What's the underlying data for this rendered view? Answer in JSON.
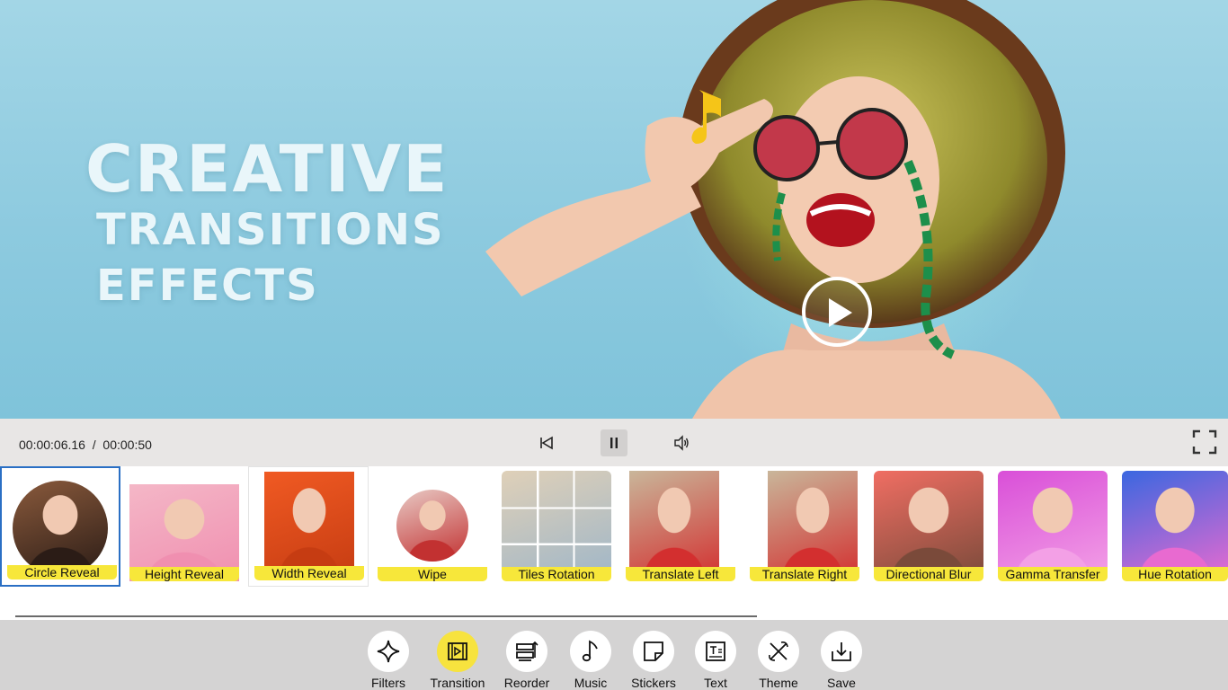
{
  "preview": {
    "headline": [
      "CREATIVE",
      "TRANSITIONS",
      "EFFECTS"
    ]
  },
  "player": {
    "current_time": "00:00:06.16",
    "separator": "/",
    "total_time": "00:00:50"
  },
  "transitions": [
    {
      "label": "Circle Reveal",
      "shape": "circle",
      "colors": [
        "#8a5a3c",
        "#2b1c16"
      ]
    },
    {
      "label": "Height Reveal",
      "shape": "rect",
      "colors": [
        "#f4b7c7",
        "#f08fb0"
      ]
    },
    {
      "label": "Width Reveal",
      "shape": "rect",
      "colors": [
        "#f05a23",
        "#c63c12"
      ]
    },
    {
      "label": "Wipe",
      "shape": "circle",
      "colors": [
        "#e8c9c4",
        "#c23131"
      ]
    },
    {
      "label": "Tiles Rotation",
      "shape": "grid",
      "colors": [
        "#dfd0b8",
        "#9fb6c8"
      ]
    },
    {
      "label": "Translate Left",
      "shape": "rect",
      "colors": [
        "#c9b69a",
        "#d32f2f"
      ]
    },
    {
      "label": "Translate Right",
      "shape": "rect",
      "colors": [
        "#c9b69a",
        "#d32f2f"
      ]
    },
    {
      "label": "Directional Blur",
      "shape": "rounded",
      "colors": [
        "#f06e63",
        "#7a4a3a"
      ]
    },
    {
      "label": "Gamma Transfer",
      "shape": "rounded",
      "colors": [
        "#d94fd8",
        "#f3a0e6"
      ]
    },
    {
      "label": "Hue Rotation",
      "shape": "rounded",
      "colors": [
        "#3a67e0",
        "#e86ad0"
      ]
    }
  ],
  "toolbar": [
    {
      "label": "Filters",
      "icon": "sparkle-icon",
      "active": false
    },
    {
      "label": "Transition",
      "icon": "transition-icon",
      "active": true
    },
    {
      "label": "Reorder",
      "icon": "reorder-icon",
      "active": false
    },
    {
      "label": "Music",
      "icon": "music-note-icon",
      "active": false
    },
    {
      "label": "Stickers",
      "icon": "sticker-icon",
      "active": false
    },
    {
      "label": "Text",
      "icon": "text-icon",
      "active": false
    },
    {
      "label": "Theme",
      "icon": "theme-icon",
      "active": false
    },
    {
      "label": "Save",
      "icon": "save-icon",
      "active": false
    }
  ],
  "colors": {
    "accent_yellow": "#f7e33e",
    "selection_blue": "#2a6fc4",
    "sky": "#8dcadf"
  }
}
